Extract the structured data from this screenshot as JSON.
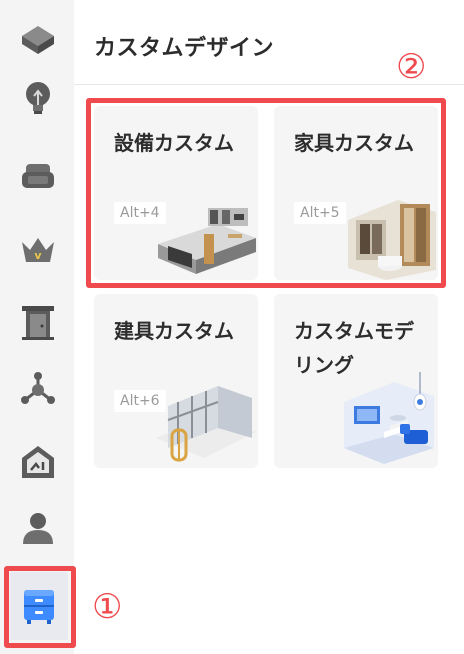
{
  "sidebar": {
    "items": [
      {
        "icon": "cube-icon",
        "label": ""
      },
      {
        "icon": "lightbulb-icon",
        "label": ""
      },
      {
        "icon": "sofa-icon",
        "label": ""
      },
      {
        "icon": "crown-icon",
        "label": ""
      },
      {
        "icon": "door-icon",
        "label": ""
      },
      {
        "icon": "molecule-icon",
        "label": ""
      },
      {
        "icon": "house-icon",
        "label": ""
      },
      {
        "icon": "person-icon",
        "label": ""
      },
      {
        "icon": "cabinet-icon",
        "label": "",
        "active": true
      }
    ]
  },
  "panel": {
    "title": "カスタムデザイン",
    "cards": [
      {
        "title": "設備カスタム",
        "shortcut": "Alt+4",
        "image": "kitchen-render"
      },
      {
        "title": "家具カスタム",
        "shortcut": "Alt+5",
        "image": "closet-render"
      },
      {
        "title": "建具カスタム",
        "shortcut": "Alt+6",
        "image": "window-render"
      },
      {
        "title": "カスタムモデリング",
        "shortcut": "",
        "image": "room-render"
      }
    ]
  },
  "annotations": {
    "marker_1": "①",
    "marker_2": "②"
  },
  "colors": {
    "accent_red": "#ef4b4f",
    "active_icon_blue": "#3d8bff",
    "icon_gray": "#5c5c5c"
  }
}
